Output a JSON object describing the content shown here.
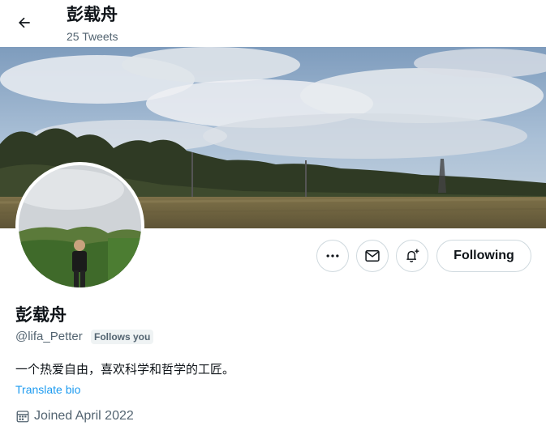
{
  "header": {
    "display_name": "彭载舟",
    "tweet_count": "25 Tweets"
  },
  "profile": {
    "display_name": "彭载舟",
    "handle": "@lifa_Petter",
    "follows_you": "Follows you",
    "bio": "一个热爱自由，喜欢科学和哲学的工匠。",
    "translate_label": "Translate bio",
    "joined": "Joined April 2022"
  },
  "actions": {
    "more_icon": "more-horizontal-icon",
    "message_icon": "envelope-icon",
    "notify_icon": "bell-plus-icon",
    "follow_label": "Following"
  },
  "colors": {
    "link": "#1d9bf0",
    "secondary_text": "#536471",
    "border": "#cfd9de",
    "badge_bg": "#eff3f4"
  }
}
